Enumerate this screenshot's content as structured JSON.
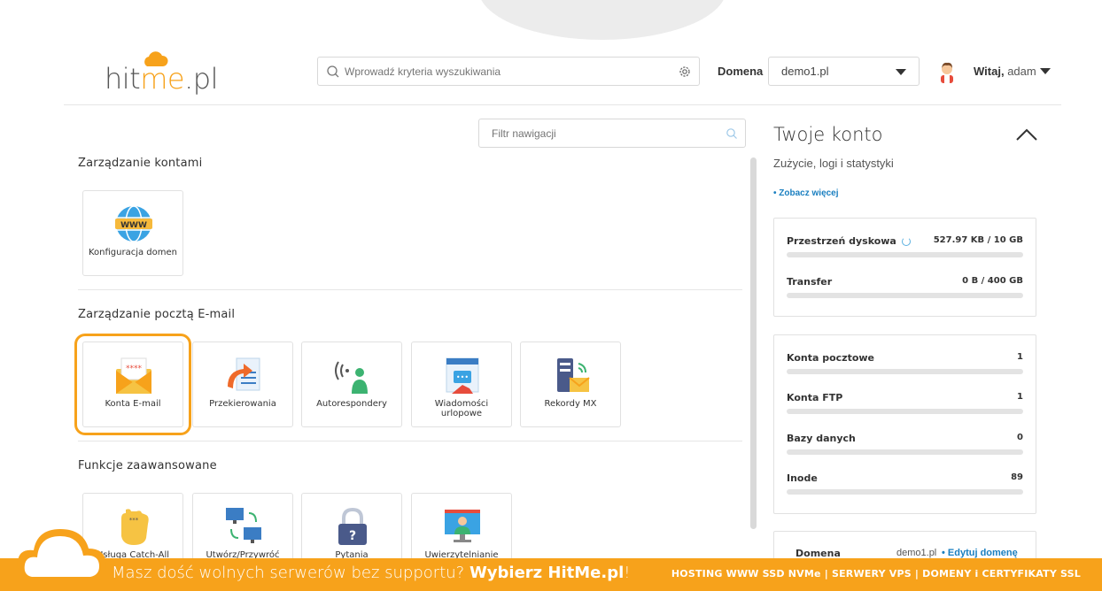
{
  "header": {
    "logo_prefix": "hit",
    "logo_accent": "me",
    "logo_suffix": ".pl",
    "search_placeholder": "Wprowadź kryteria wyszukiwania",
    "domain_label": "Domena",
    "domain_value": "demo1.pl",
    "greeting_strong": "Witaj,",
    "greeting_user": "adam"
  },
  "nav": {
    "filter_placeholder": "Filtr nawigacji",
    "sections": [
      {
        "title": "Zarządzanie kontami",
        "tiles": [
          {
            "label": "Konfiguracja domen",
            "icon": "www-globe-icon"
          }
        ]
      },
      {
        "title": "Zarządzanie pocztą E-mail",
        "tiles": [
          {
            "label": "Konta E-mail",
            "icon": "mail-envelope-icon",
            "selected": true
          },
          {
            "label": "Przekierowania",
            "icon": "forward-arrow-icon"
          },
          {
            "label": "Autorespondery",
            "icon": "autoresponder-person-icon"
          },
          {
            "label": "Wiadomości urlopowe",
            "icon": "vacation-message-icon"
          },
          {
            "label": "Rekordy MX",
            "icon": "mx-server-icon"
          }
        ]
      },
      {
        "title": "Funkcje zaawansowane",
        "tiles": [
          {
            "label": "Usługa Catch-All",
            "icon": "catch-all-hand-icon"
          },
          {
            "label": "Utwórz/Przywróć",
            "icon": "backup-computers-icon"
          },
          {
            "label": "Pytania",
            "icon": "lock-question-icon"
          },
          {
            "label": "Uwierzytelnianie",
            "icon": "authentication-screen-icon"
          }
        ]
      }
    ]
  },
  "account": {
    "title": "Twoje konto",
    "subtitle": "Zużycie, logi i statystyki",
    "more_link": "• Zobacz więcej",
    "usage": [
      {
        "label": "Przestrzeń dyskowa",
        "value": "527.97 KB / 10 GB",
        "fill": 0.0
      },
      {
        "label": "Transfer",
        "value": "0 B / 400 GB",
        "fill": 0.0
      }
    ],
    "counts": [
      {
        "label": "Konta pocztowe",
        "value": "1"
      },
      {
        "label": "Konta FTP",
        "value": "1"
      },
      {
        "label": "Bazy danych",
        "value": "0"
      },
      {
        "label": "Inode",
        "value": "89"
      }
    ],
    "domain_row": {
      "label": "Domena",
      "value": "demo1.pl",
      "edit_link": "• Edytuj domenę"
    }
  },
  "banner": {
    "text_plain": "Masz dość wolnych serwerów bez supportu? ",
    "text_bold": "Wybierz HitMe.pl",
    "text_end": "!",
    "right": "HOSTING WWW SSD NVMe | SERWERY VPS | DOMENY i CERTYFIKATY SSL"
  },
  "colors": {
    "accent": "#f7a21b",
    "link": "#1a7fc0"
  }
}
